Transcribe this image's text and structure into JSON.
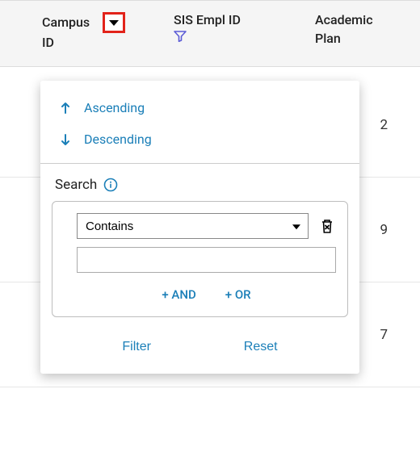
{
  "columns": {
    "campus_id": {
      "line1": "Campus",
      "line2": "ID"
    },
    "sis_empl": {
      "line1": "SIS Empl ID"
    },
    "plan": {
      "line1": "Academic",
      "line2": "Plan"
    }
  },
  "rows": {
    "r1_tail": "2",
    "r2_tail": "9",
    "r3_tail": "7"
  },
  "popup": {
    "sort_asc": "Ascending",
    "sort_desc": "Descending",
    "search_label": "Search",
    "operator_value": "Contains",
    "value_input": "",
    "add_and": "+ AND",
    "add_or": "+ OR",
    "filter_btn": "Filter",
    "reset_btn": "Reset"
  }
}
